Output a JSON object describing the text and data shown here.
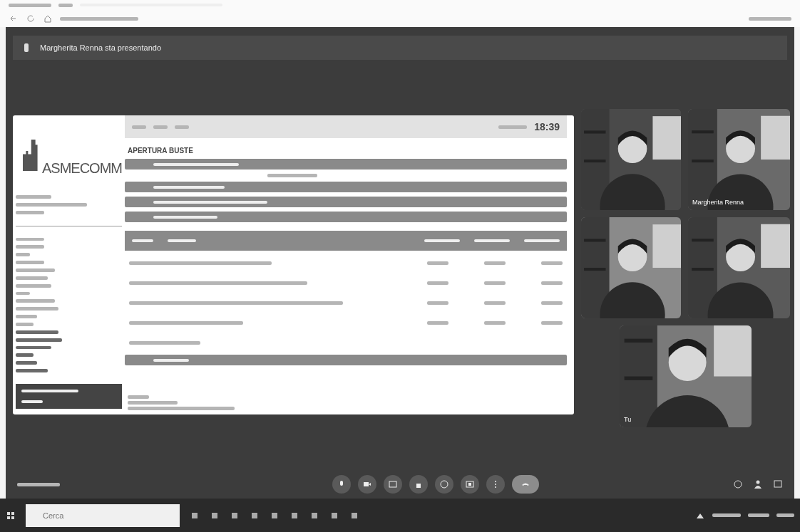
{
  "presenter_banner": "Margherita Renna sta presentando",
  "shared_screen": {
    "logo": "ASMECOMM",
    "title": "APERTURA BUSTE",
    "clock": "18:39"
  },
  "tiles": [
    {
      "kind": "picture"
    },
    {
      "kind": "picture",
      "label": "Margherita Renna"
    },
    {
      "kind": "picture"
    },
    {
      "kind": "picture"
    },
    {
      "kind": "picture",
      "label": "Tu"
    }
  ],
  "taskbar": {
    "search_placeholder": "Cerca"
  }
}
